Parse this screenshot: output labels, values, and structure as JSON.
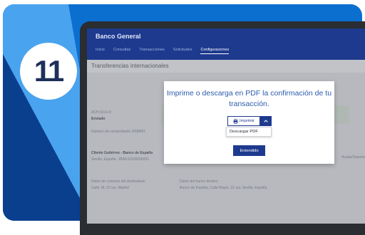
{
  "step": {
    "number": "11"
  },
  "app": {
    "brand": "Banco General",
    "nav": [
      "Inicio",
      "Consultas",
      "Transacciones",
      "Solicitudes",
      "Configuraciones"
    ],
    "page_title": "Transferencias internacionales"
  },
  "background": {
    "ref_1": "ACH-5012-8",
    "ref_2": "Enviado",
    "ref_3": "Número de comprobante 0098861",
    "beneficiary_name": "Cliente Gutiérrez - Banco de España",
    "beneficiary_place": "Sevilla, España - IBAN ES28300091",
    "recipient_label": "Datos de contacto del destinatario",
    "recipient_value": "Calle 18, 23 sur, Madrid",
    "bank_label": "Datos del banco destino",
    "bank_value": "Banco de España, Calle Mayor, 22 sur, Sevilla, España",
    "side_label": "Ayuda/Soporte"
  },
  "modal": {
    "message": "Imprime o descarga en PDF la confirmación de tu transacción.",
    "print_label": "Imprimir",
    "menu_item": "Descargar PDF",
    "confirm_label": "Entendido"
  },
  "colors": {
    "primary": "#1e3a8f",
    "card_bg": "#0b6fd0",
    "card_light": "#4aa3ee",
    "card_dark": "#0a3f8e",
    "modal_text": "#2b5caa"
  },
  "icons": {
    "print": "printer-icon",
    "caret": "chevron-up-icon"
  }
}
